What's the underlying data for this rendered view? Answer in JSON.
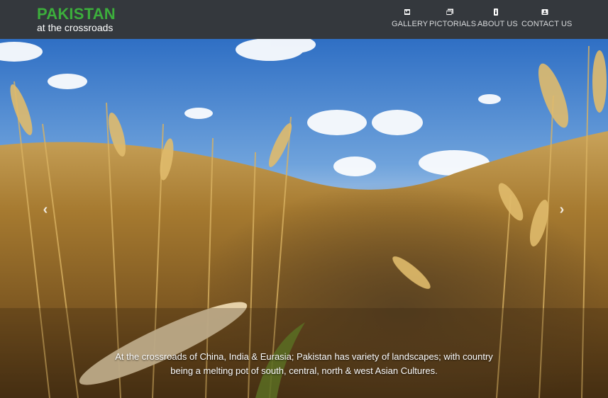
{
  "brand": {
    "title": "PAKISTAN",
    "subtitle": "at the crossroads",
    "title_color": "#3cae3c"
  },
  "nav": {
    "items": [
      {
        "label": "GALLERY",
        "icon": "image-icon"
      },
      {
        "label": "PICTORIALS",
        "icon": "pictures-icon"
      },
      {
        "label": "ABOUT US",
        "icon": "info-icon"
      },
      {
        "label": "CONTACT US",
        "icon": "contact-card-icon"
      }
    ]
  },
  "carousel": {
    "prev_icon": "‹",
    "next_icon": "›",
    "caption_line1": "At the crossroads of China, India & Eurasia; Pakistan has variety of landscapes; with country",
    "caption_line2": "being a melting pot of south, central, north & west Asian Cultures."
  },
  "colors": {
    "navbar": "#34383d",
    "nav_text": "#d8dadc",
    "accent": "#3cae3c"
  }
}
